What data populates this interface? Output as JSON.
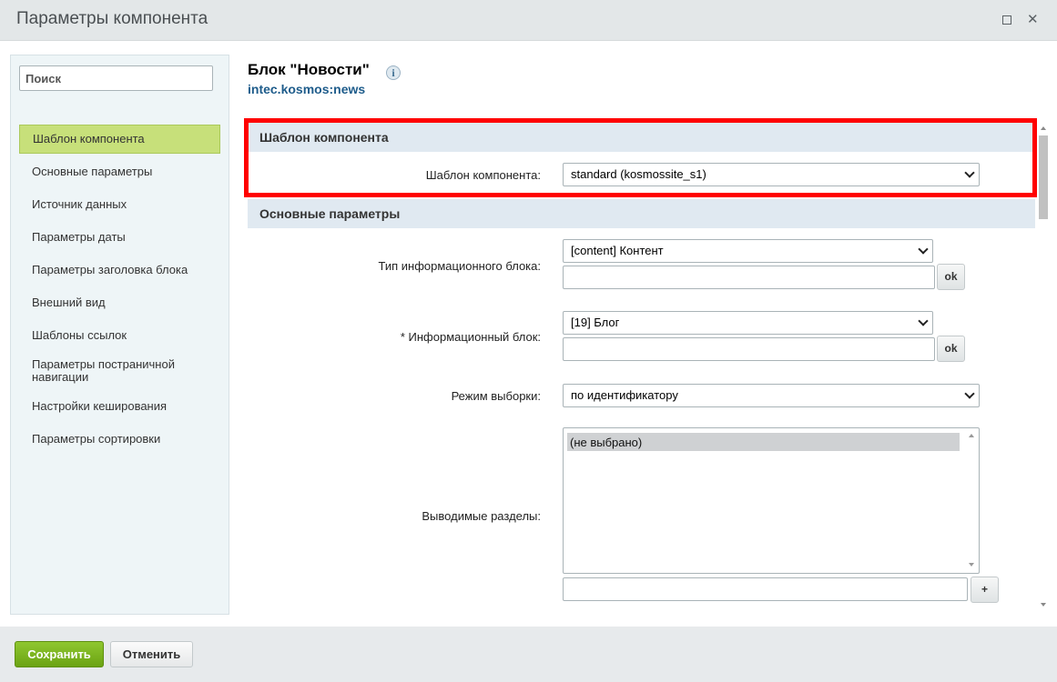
{
  "dialog": {
    "title": "Параметры компонента"
  },
  "sidebar": {
    "search_placeholder": "Поиск",
    "items": [
      {
        "label": "Шаблон компонента"
      },
      {
        "label": "Основные параметры"
      },
      {
        "label": "Источник данных"
      },
      {
        "label": "Параметры даты"
      },
      {
        "label": "Параметры заголовка блока"
      },
      {
        "label": "Внешний вид"
      },
      {
        "label": "Шаблоны ссылок"
      },
      {
        "label": "Параметры постраничной навигации"
      },
      {
        "label": "Настройки кеширования"
      },
      {
        "label": "Параметры сортировки"
      }
    ]
  },
  "component": {
    "title": "Блок \"Новости\"",
    "info_icon": "i",
    "code": "intec.kosmos:news"
  },
  "sections": {
    "template": {
      "header": "Шаблон компонента",
      "template_label": "Шаблон компонента:",
      "template_value": "standard (kosmossite_s1)"
    },
    "main": {
      "header": "Основные параметры",
      "iblock_type_label": "Тип информационного блока:",
      "iblock_type_value": "[content] Контент",
      "iblock_label": "* Информационный блок:",
      "iblock_value": "[19] Блог",
      "mode_label": "Режим выборки:",
      "mode_value": "по идентификатору",
      "sections_label": "Выводимые разделы:",
      "sections_option": "(не выбрано)",
      "ok_label": "ok",
      "add_label": "+"
    }
  },
  "footer": {
    "save_label": "Сохранить",
    "cancel_label": "Отменить"
  },
  "colors": {
    "accent_green": "#7ab51d",
    "active_nav": "#c7e07a",
    "section_header": "#e0e9f1",
    "highlight": "#ff0000",
    "link": "#1e5c8b"
  }
}
